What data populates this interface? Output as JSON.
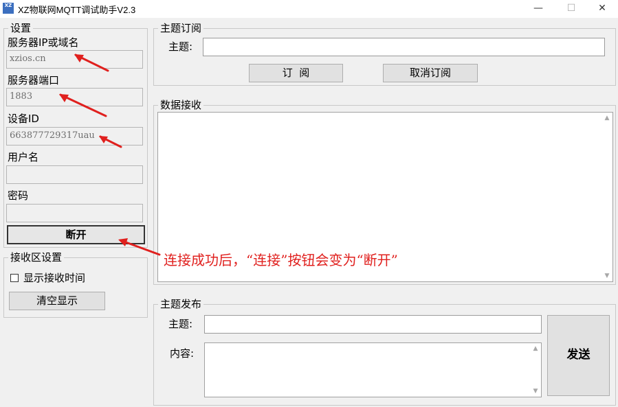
{
  "window": {
    "title": "XZ物联网MQTT调试助手V2.3",
    "icon_text": "XZ",
    "minimize": "—",
    "maximize": "☐",
    "close": "✕"
  },
  "settings": {
    "group_title": "设置",
    "server_label": "服务器IP或域名",
    "server_value": "xzios.cn",
    "port_label": "服务器端口",
    "port_value": "1883",
    "device_id_label": "设备ID",
    "device_id_value": "663877729317uau",
    "username_label": "用户名",
    "username_value": "",
    "password_label": "密码",
    "password_value": "",
    "disconnect_button": "断开"
  },
  "receive_settings": {
    "group_title": "接收区设置",
    "show_time_label": "显示接收时间",
    "show_time_checked": false,
    "clear_button": "清空显示"
  },
  "subscribe": {
    "group_title": "主题订阅",
    "topic_label": "主题:",
    "topic_value": "",
    "subscribe_button": "订  阅",
    "unsubscribe_button": "取消订阅"
  },
  "receive": {
    "group_title": "数据接收",
    "content": ""
  },
  "publish": {
    "group_title": "主题发布",
    "topic_label": "主题:",
    "topic_value": "",
    "content_label": "内容:",
    "content_value": "",
    "send_button": "发送"
  },
  "annotation": {
    "text": "连接成功后，“连接”按钮会变为“断开”",
    "color": "#e0201e"
  }
}
